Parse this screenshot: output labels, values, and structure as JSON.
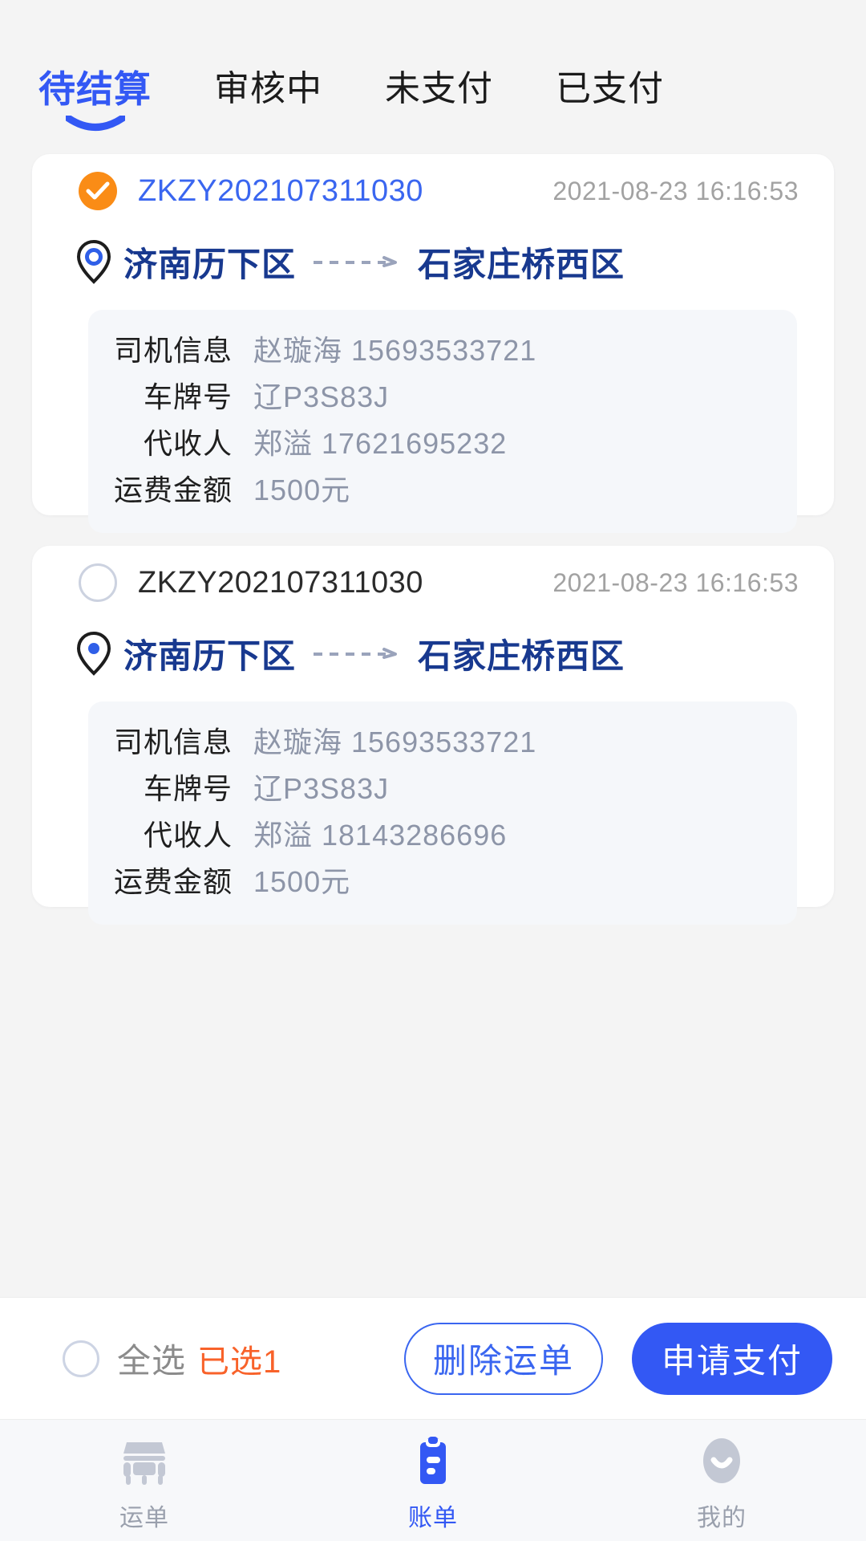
{
  "tabs": [
    {
      "label": "待结算",
      "active": true
    },
    {
      "label": "审核中",
      "active": false
    },
    {
      "label": "未支付",
      "active": false
    },
    {
      "label": "已支付",
      "active": false
    }
  ],
  "cards": [
    {
      "checked": true,
      "order_no": "ZKZY202107311030",
      "timestamp": "2021-08-23 16:16:53",
      "origin": "济南历下区",
      "destination": "石家庄桥西区",
      "details": [
        {
          "label": "司机信息",
          "value": "赵璇海  15693533721"
        },
        {
          "label": "车牌号",
          "value": "辽P3S83J"
        },
        {
          "label": "代收人",
          "value": "郑溢  17621695232"
        },
        {
          "label": "运费金额",
          "value": "1500元"
        }
      ]
    },
    {
      "checked": false,
      "order_no": "ZKZY202107311030",
      "timestamp": "2021-08-23 16:16:53",
      "origin": "济南历下区",
      "destination": "石家庄桥西区",
      "details": [
        {
          "label": "司机信息",
          "value": "赵璇海  15693533721"
        },
        {
          "label": "车牌号",
          "value": "辽P3S83J"
        },
        {
          "label": "代收人",
          "value": "郑溢  18143286696"
        },
        {
          "label": "运费金额",
          "value": "1500元"
        }
      ]
    }
  ],
  "actionbar": {
    "select_all_label": "全选",
    "selected_count_label": "已选1",
    "delete_button": "删除运单",
    "pay_button": "申请支付"
  },
  "bottomnav": [
    {
      "label": "运单",
      "icon": "truck-icon",
      "active": false
    },
    {
      "label": "账单",
      "icon": "clipboard-icon",
      "active": true
    },
    {
      "label": "我的",
      "icon": "user-avatar-icon",
      "active": false
    }
  ],
  "colors": {
    "accent_blue": "#3358f4",
    "city_blue": "#18398f",
    "order_blue": "#3a66f0",
    "checked_orange": "#fa8c16",
    "count_orange": "#f8622a",
    "page_bg": "#f4f4f4",
    "panel_bg": "#f5f7fa",
    "muted": "#8d95a8"
  }
}
